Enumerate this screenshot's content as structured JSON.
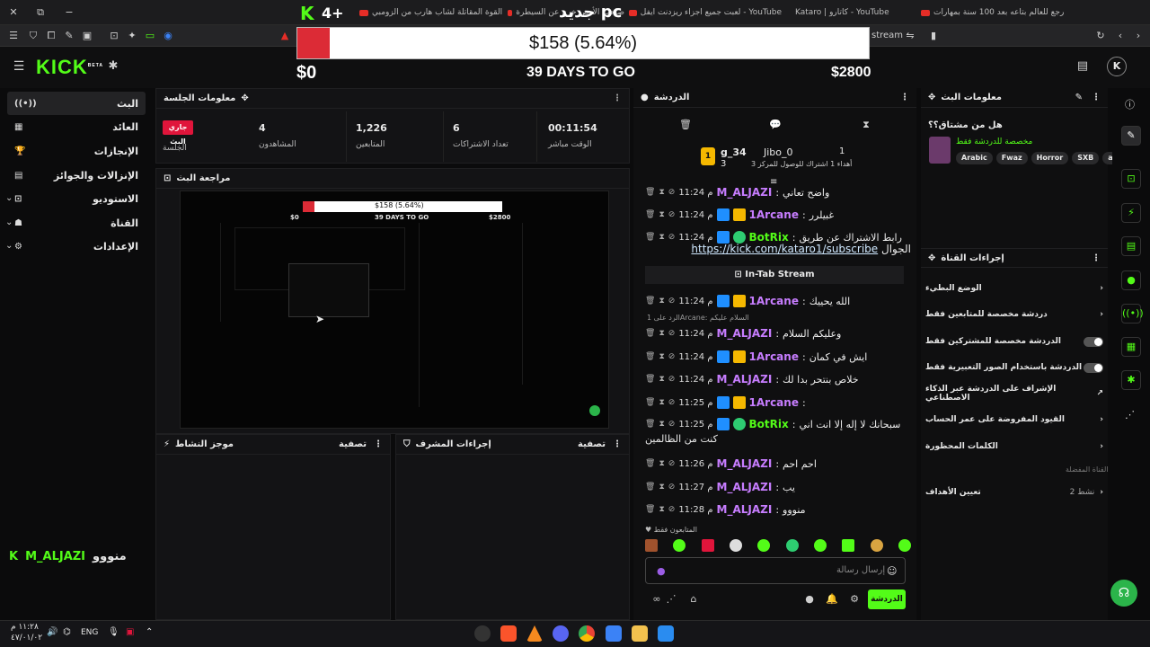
{
  "browser": {
    "tabs": [
      {
        "label": "رجع للعالم بتاعه بعد 100 سنة بمهارات"
      },
      {
        "label": "Kataro | كاتارو - YouTube"
      },
      {
        "label": "لعبت جميع اجزاء ريزدنت ايفل - YouTube"
      },
      {
        "label": "صاحب الأرض خرج عن السيطرة"
      },
      {
        "label": "القوة المقاتلة لشاب هارب من الزومبي"
      }
    ],
    "address_partial": "stream",
    "overlay_left": "4+",
    "overlay_right": "جديد pc"
  },
  "goal": {
    "amount_text": "$158 (5.64%)",
    "percent": 5.64,
    "min": "$0",
    "max": "$2800",
    "days": "39 DAYS TO GO"
  },
  "header": {
    "logo": "KICK",
    "logo_sup": "BETA"
  },
  "nav": {
    "items": [
      {
        "label": "البث",
        "icon": "((•))"
      },
      {
        "label": "العائد",
        "icon": "▦"
      },
      {
        "label": "الإنجازات",
        "icon": "🏆"
      },
      {
        "label": "الإنزالات والجوائز",
        "icon": "▤"
      },
      {
        "label": "الاستوديو",
        "icon": "⊡"
      },
      {
        "label": "القناة",
        "icon": "☗"
      },
      {
        "label": "الإعدادات",
        "icon": "⚙"
      }
    ],
    "footer_name": "M_ALJAZI",
    "footer_msg": "منووو"
  },
  "session": {
    "title": "معلومات الجلسة",
    "live_badge": "جاري البث",
    "session_label": "الجلسة",
    "stats": [
      {
        "value": "4",
        "label": "المشاهدون"
      },
      {
        "value": "1,226",
        "label": "المتابعين"
      },
      {
        "value": "6",
        "label": "تعداد الاشتراكات"
      },
      {
        "value": "00:11:54",
        "label": "الوقت مباشر"
      }
    ]
  },
  "preview": {
    "title": "مراجعة البث",
    "mini_goal": "$158 (5.64%)",
    "mini_days": "39 DAYS TO GO",
    "mini_min": "$0",
    "mini_max": "$2800"
  },
  "bottom_panels": [
    {
      "title": "موجز النشاط",
      "filter": "تصفية"
    },
    {
      "title": "إجراءات المشرف",
      "filter": "تصفية"
    }
  ],
  "chat": {
    "title": "الدردشة",
    "top_users": [
      {
        "name": "g_34",
        "count": "3",
        "rank": "1"
      },
      {
        "name": "Jibo_0",
        "count": "1"
      }
    ],
    "gift_text": "أهداء 1 اشتراك للوصول للمركز 3",
    "messages": [
      {
        "time": "11:24 م",
        "user": "M_ALJAZI",
        "color": "#c77dff",
        "text": "واضح تعاني",
        "badges": []
      },
      {
        "time": "11:24 م",
        "user": "1Arcane",
        "color": "#c77dff",
        "text": "غبيلرر",
        "badges": [
          "mod",
          "crown"
        ]
      },
      {
        "time": "11:24 م",
        "user": "BotRix",
        "color": "#53fc18",
        "text": "رابط الاشتراك عن طريق",
        "badges": [
          "mod",
          "ver"
        ]
      },
      {
        "time": "11:24 م",
        "user": "1Arcane",
        "color": "#c77dff",
        "text": "الله يحييك",
        "badges": [
          "mod",
          "crown"
        ]
      },
      {
        "time": "11:24 م",
        "user": "M_ALJAZI",
        "color": "#c77dff",
        "text": "وعليكم السلام",
        "badges": []
      },
      {
        "time": "11:24 م",
        "user": "1Arcane",
        "color": "#c77dff",
        "text": "ايش في كمان",
        "badges": [
          "mod",
          "crown"
        ]
      },
      {
        "time": "11:24 م",
        "user": "M_ALJAZI",
        "color": "#c77dff",
        "text": "خلاص بنتحر بدا لك",
        "badges": []
      },
      {
        "time": "11:25 م",
        "user": "1Arcane",
        "color": "#c77dff",
        "text": "",
        "badges": [
          "mod",
          "crown"
        ]
      },
      {
        "time": "11:25 م",
        "user": "BotRix",
        "color": "#53fc18",
        "text": "سبحانك لا إله إلا انت اني",
        "badges": [
          "mod",
          "ver"
        ]
      },
      {
        "time": "11:26 م",
        "user": "M_ALJAZI",
        "color": "#c77dff",
        "text": "احم احم",
        "badges": []
      },
      {
        "time": "11:27 م",
        "user": "M_ALJAZI",
        "color": "#c77dff",
        "text": "يب",
        "badges": []
      },
      {
        "time": "11:28 م",
        "user": "M_ALJAZI",
        "color": "#c77dff",
        "text": "منووو",
        "badges": []
      }
    ],
    "link_line": "الجوال",
    "link": "https://kick.com/kataro1/subscribe",
    "intab": "In-Tab Stream",
    "reply_hint": "الرد على 1Arcane: السلام عليكم",
    "wrap_line": "كنت من الظالمين",
    "followers_only": "المتابعون فقط",
    "input_placeholder": "إرسال رسالة",
    "send_label": "الدردشة"
  },
  "stream_info": {
    "title": "معلومات البث",
    "question": "هل من مشتاق؟؟",
    "subtitle": "مخصصة للدردشة فقط",
    "tags": [
      "Arabic",
      "Fwaz",
      "Horror",
      "SXB",
      "a"
    ]
  },
  "channel_actions": {
    "title": "إجراءات القناة",
    "rows": [
      {
        "label": "الوضع البطيء",
        "control": "chevron"
      },
      {
        "label": "دردشة مخصصة للمتابعين فقط",
        "control": "chevron"
      },
      {
        "label": "الدردشة مخصصة للمشتركين فقط",
        "control": "toggle"
      },
      {
        "label": "الدردشة باستخدام الصور التعبيرية فقط",
        "control": "toggle"
      },
      {
        "label": "الإشراف على الدردشة عبر الذكاء الاصطناعي",
        "control": "external"
      },
      {
        "label": "القيود المفروضة على عمر الحساب",
        "control": "chevron"
      },
      {
        "label": "الكلمات المحظورة",
        "control": "chevron"
      }
    ],
    "section_label": "القناة المفضلة",
    "goals_label": "تعيين الأهداف",
    "goals_value": "2 نشط"
  },
  "taskbar": {
    "time": "١١:٢٨ م",
    "date": "٤٧/٠١/٠٢",
    "lang": "ENG"
  }
}
